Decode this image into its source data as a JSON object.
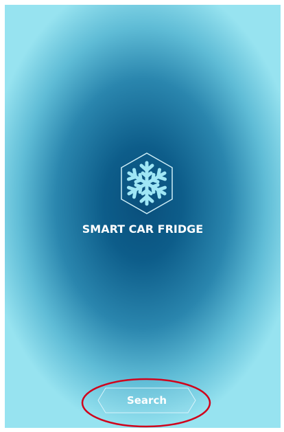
{
  "app": {
    "title": "SMART CAR FRIDGE",
    "logo_icon": "snowflake-icon"
  },
  "actions": {
    "search_label": "Search"
  },
  "annotation": {
    "highlight_color": "#d0021b"
  },
  "colors": {
    "background_center": "#0a4f7c",
    "background_edge": "#97e3f0",
    "snowflake": "#9fe6f5",
    "text": "#ffffff"
  }
}
